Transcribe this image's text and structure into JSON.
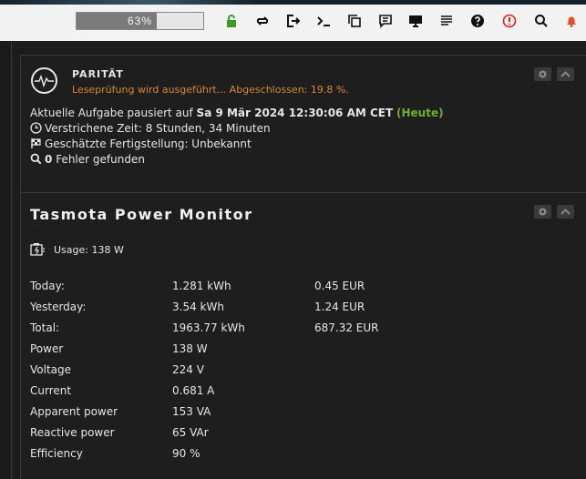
{
  "header": {
    "cpu_percent": 63,
    "cpu_label": "63%",
    "icons": [
      "lock-icon",
      "repeat-icon",
      "logout-icon",
      "terminal-icon",
      "copy-icon",
      "chat-icon",
      "monitor-icon",
      "log-icon",
      "help-icon",
      "alert-icon",
      "search-icon",
      "bell-icon"
    ],
    "colors": {
      "lock": "#3a9a2a",
      "alert": "#e02020",
      "bell": "#e05020"
    }
  },
  "parity": {
    "title": "PARITÄT",
    "status": "Leseprüfung wird ausgeführt... Abgeschlossen: 19.8 %.",
    "paused_prefix": "Aktuelle Aufgabe pausiert auf ",
    "paused_date": "Sa 9 Mär 2024 12:30:06 AM CET",
    "paused_today": "(Heute)",
    "elapsed": "Verstrichene Zeit: 8 Stunden, 34 Minuten",
    "eta": "Geschätzte Fertigstellung: Unbekannt",
    "errors_count": "0",
    "errors_label": "Fehler gefunden"
  },
  "tasmota": {
    "title": "Tasmota Power Monitor",
    "usage": "Usage: 138 W",
    "rows": [
      {
        "label": "Today:",
        "value": "1.281 kWh",
        "cost": "0.45 EUR"
      },
      {
        "label": "Yesterday:",
        "value": "3.54 kWh",
        "cost": "1.24 EUR"
      },
      {
        "label": "Total:",
        "value": "1963.77 kWh",
        "cost": "687.32 EUR"
      },
      {
        "label": "Power",
        "value": "138 W",
        "cost": ""
      },
      {
        "label": "Voltage",
        "value": "224 V",
        "cost": ""
      },
      {
        "label": "Current",
        "value": "0.681 A",
        "cost": ""
      },
      {
        "label": "Apparent power",
        "value": "153 VA",
        "cost": ""
      },
      {
        "label": "Reactive power",
        "value": "65 VAr",
        "cost": ""
      },
      {
        "label": "Efficiency",
        "value": "90 %",
        "cost": ""
      }
    ]
  }
}
